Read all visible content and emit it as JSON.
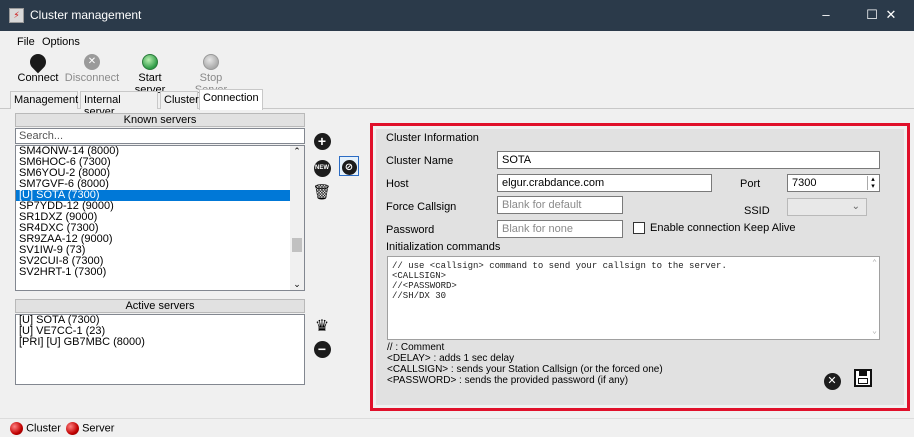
{
  "window": {
    "title": "Cluster management",
    "controls": [
      "–",
      "☐",
      "✕"
    ]
  },
  "menu": {
    "file": "File",
    "options": "Options"
  },
  "toolbar": {
    "connect": "Connect",
    "disconnect": "Disconnect",
    "start_server": "Start server",
    "stop_server": "Stop Server"
  },
  "tabs": [
    "Management",
    "Internal server",
    "Cluster",
    "Connection"
  ],
  "known_servers": {
    "header": "Known servers",
    "search_placeholder": "Search...",
    "items": [
      "SM4ONW-14 (8000)",
      "SM6HOC-6 (7300)",
      "SM6YOU-2 (8000)",
      "SM7GVF-6 (8000)",
      "[U] SOTA (7300)",
      "SP7YDD-12 (9000)",
      "SR1DXZ (9000)",
      "SR4DXC (7300)",
      "SR9ZAA-12 (9000)",
      "SV1IW-9 (73)",
      "SV2CUI-8 (7300)",
      "SV2HRT-1 (7300)"
    ],
    "selected_index": 4
  },
  "active_servers": {
    "header": "Active servers",
    "items": [
      "[U] SOTA (7300)",
      "[U] VE7CC-1 (23)",
      "[PRI] [U] GB7MBC (8000)"
    ]
  },
  "cluster_info": {
    "section": "Cluster Information",
    "name_label": "Cluster Name",
    "name_value": "SOTA",
    "host_label": "Host",
    "host_value": "elgur.crabdance.com",
    "port_label": "Port",
    "port_value": "7300",
    "force_callsign_label": "Force Callsign",
    "force_callsign_placeholder": "Blank for default",
    "ssid_label": "SSID",
    "password_label": "Password",
    "password_placeholder": "Blank for none",
    "keepalive_label": "Enable connection Keep Alive",
    "init_label": "Initialization commands",
    "init_lines": [
      "// use <callsign> command to send your callsign to the server.",
      "<CALLSIGN>",
      "//<PASSWORD>",
      "//SH/DX 30"
    ],
    "hints": [
      "// : Comment",
      "<DELAY> : adds 1 sec delay",
      "<CALLSIGN> : sends your Station Callsign (or the forced one)",
      "<PASSWORD> : sends the provided password (if any)"
    ]
  },
  "status": {
    "cluster": "Cluster",
    "server": "Server"
  }
}
